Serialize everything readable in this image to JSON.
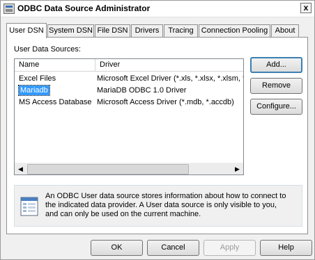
{
  "window": {
    "title": "ODBC Data Source Administrator",
    "close_glyph": "x"
  },
  "tabs": [
    {
      "label": "User DSN",
      "active": true
    },
    {
      "label": "System DSN",
      "active": false
    },
    {
      "label": "File DSN",
      "active": false
    },
    {
      "label": "Drivers",
      "active": false
    },
    {
      "label": "Tracing",
      "active": false
    },
    {
      "label": "Connection Pooling",
      "active": false
    },
    {
      "label": "About",
      "active": false
    }
  ],
  "panel": {
    "section_label": "User Data Sources:",
    "columns": [
      "Name",
      "Driver"
    ],
    "rows": [
      {
        "name": "Excel Files",
        "driver": "Microsoft Excel Driver (*.xls, *.xlsx, *.xlsm, *.x",
        "selected": false
      },
      {
        "name": "Mariadb",
        "driver": "MariaDB ODBC 1.0 Driver",
        "selected": true
      },
      {
        "name": "MS Access Database",
        "driver": "Microsoft Access Driver (*.mdb, *.accdb)",
        "selected": false
      }
    ],
    "scroll_left_glyph": "◀",
    "scroll_right_glyph": "▶",
    "buttons": {
      "add": "Add...",
      "remove": "Remove",
      "configure": "Configure..."
    },
    "info_icon": "data-source-icon",
    "info_lines": [
      "An ODBC User data source stores information about how to connect to",
      "the indicated data provider.  A User data source is only visible to you,",
      "and can only be used on the current machine."
    ]
  },
  "footer": {
    "ok": "OK",
    "cancel": "Cancel",
    "apply": "Apply",
    "help": "Help"
  },
  "colors": {
    "selection": "#3399ff",
    "default_button_border": "#3c7fb1"
  }
}
